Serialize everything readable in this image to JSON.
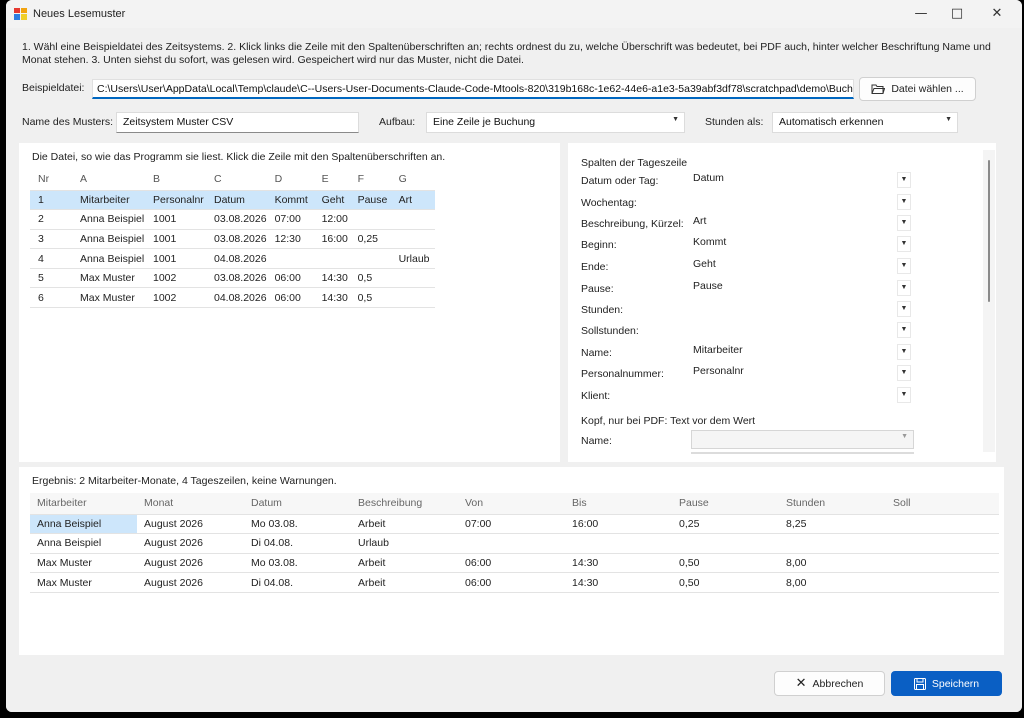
{
  "window": {
    "title": "Neues Lesemuster"
  },
  "instructions": "1. Wähl eine Beispieldatei des Zeitsystems. 2. Klick links die Zeile mit den Spaltenüberschriften an; rechts ordnest du zu, welche Überschrift was bedeutet, bei PDF auch, hinter welcher Beschriftung Name und Monat stehen. 3. Unten siehst du sofort, was gelesen wird. Gespeichert wird nur das Muster, nicht die Datei.",
  "file": {
    "label": "Beispieldatei:",
    "path": "C:\\Users\\User\\AppData\\Local\\Temp\\claude\\C--Users-User-Documents-Claude-Code-Mtools-820\\319b168c-1e62-44e6-a1e3-5a39abf3df78\\scratchpad\\demo\\Buchung",
    "choose_button": "Datei wählen ..."
  },
  "pattern": {
    "name_label": "Name des Musters:",
    "name_value": "Zeitsystem Muster CSV",
    "layout_label": "Aufbau:",
    "layout_value": "Eine Zeile je Buchung",
    "hours_label": "Stunden als:",
    "hours_value": "Automatisch erkennen"
  },
  "left_panel": {
    "caption": "Die Datei, so wie das Programm sie liest. Klick die Zeile mit den Spaltenüberschriften an.",
    "columns": [
      "Nr",
      "A",
      "B",
      "C",
      "D",
      "E",
      "F",
      "G"
    ],
    "rows": [
      [
        "1",
        "Mitarbeiter",
        "Personalnr",
        "Datum",
        "Kommt",
        "Geht",
        "Pause",
        "Art"
      ],
      [
        "2",
        "Anna Beispiel",
        "1001",
        "03.08.2026",
        "07:00",
        "12:00",
        "",
        ""
      ],
      [
        "3",
        "Anna Beispiel",
        "1001",
        "03.08.2026",
        "12:30",
        "16:00",
        "0,25",
        ""
      ],
      [
        "4",
        "Anna Beispiel",
        "1001",
        "04.08.2026",
        "",
        "",
        "",
        "Urlaub"
      ],
      [
        "5",
        "Max Muster",
        "1002",
        "03.08.2026",
        "06:00",
        "14:30",
        "0,5",
        ""
      ],
      [
        "6",
        "Max Muster",
        "1002",
        "04.08.2026",
        "06:00",
        "14:30",
        "0,5",
        ""
      ]
    ]
  },
  "right_panel": {
    "heading": "Spalten der Tageszeile",
    "mappings": [
      {
        "label": "Datum oder Tag:",
        "value": "Datum"
      },
      {
        "label": "Wochentag:",
        "value": ""
      },
      {
        "label": "Beschreibung, Kürzel:",
        "value": "Art"
      },
      {
        "label": "Beginn:",
        "value": "Kommt"
      },
      {
        "label": "Ende:",
        "value": "Geht"
      },
      {
        "label": "Pause:",
        "value": "Pause"
      },
      {
        "label": "Stunden:",
        "value": ""
      },
      {
        "label": "Sollstunden:",
        "value": ""
      },
      {
        "label": "Name:",
        "value": "Mitarbeiter"
      },
      {
        "label": "Personalnummer:",
        "value": "Personalnr"
      },
      {
        "label": "Klient:",
        "value": ""
      }
    ],
    "pdf_heading": "Kopf, nur bei PDF: Text vor dem Wert",
    "pdf_name_label": "Name:"
  },
  "result": {
    "summary": "Ergebnis: 2 Mitarbeiter-Monate, 4 Tageszeilen, keine Warnungen.",
    "columns": [
      "Mitarbeiter",
      "Monat",
      "Datum",
      "Beschreibung",
      "Von",
      "Bis",
      "Pause",
      "Stunden",
      "Soll"
    ],
    "rows": [
      [
        "Anna Beispiel",
        "August 2026",
        "Mo 03.08.",
        "Arbeit",
        "07:00",
        "16:00",
        "0,25",
        "8,25",
        ""
      ],
      [
        "Anna Beispiel",
        "August 2026",
        "Di 04.08.",
        "Urlaub",
        "",
        "",
        "",
        "",
        ""
      ],
      [
        "Max Muster",
        "August 2026",
        "Mo 03.08.",
        "Arbeit",
        "06:00",
        "14:30",
        "0,50",
        "8,00",
        ""
      ],
      [
        "Max Muster",
        "August 2026",
        "Di 04.08.",
        "Arbeit",
        "06:00",
        "14:30",
        "0,50",
        "8,00",
        ""
      ]
    ]
  },
  "footer": {
    "cancel_label": "Abbrechen",
    "save_label": "Speichern"
  }
}
